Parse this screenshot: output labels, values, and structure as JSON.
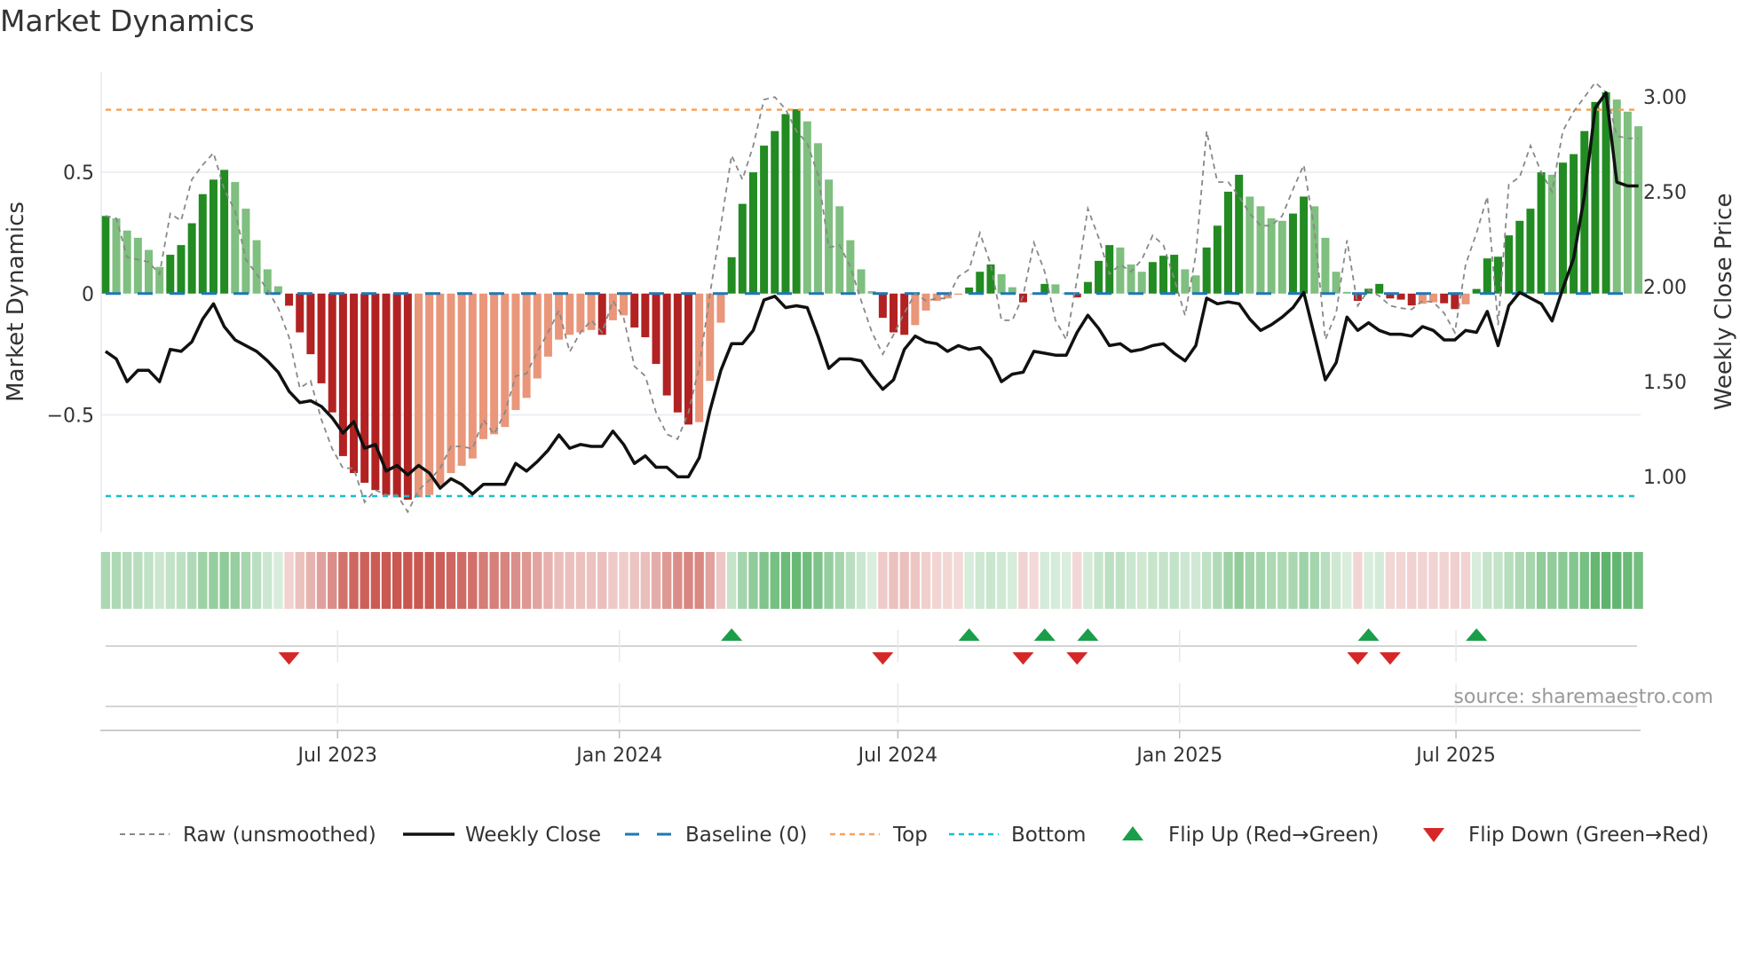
{
  "title": "Market Dynamics",
  "source": "source: sharemaestro.com",
  "colors": {
    "up_strong": "#228b22",
    "up_weak": "#7fbf7f",
    "down_strong": "#b22222",
    "down_weak": "#e9967a",
    "raw": "#888888",
    "close": "#111111",
    "baseline": "#1f77b4",
    "top": "#f4a460",
    "bottom": "#17becf",
    "flip_up": "#1a9e4a",
    "flip_down": "#d62728",
    "heat_green": "#5cb36a",
    "heat_red": "#c9564f"
  },
  "legend": [
    {
      "key": "raw",
      "label": "Raw (unsmoothed)"
    },
    {
      "key": "close",
      "label": "Weekly Close"
    },
    {
      "key": "baseline",
      "label": "Baseline (0)"
    },
    {
      "key": "top",
      "label": "Top"
    },
    {
      "key": "bottom",
      "label": "Bottom"
    },
    {
      "key": "flip_up",
      "label": "Flip Up (Red→Green)"
    },
    {
      "key": "flip_down",
      "label": "Flip Down (Green→Red)"
    }
  ],
  "chart_data": {
    "type": "bar",
    "title": "Market Dynamics",
    "ylabel": "Market Dynamics",
    "y2label": "Weekly Close Price",
    "x_unit": "week index",
    "xlim": [
      -0.4,
      142.2
    ],
    "ylim": [
      -0.985,
      0.914
    ],
    "y2lim": [
      0.707,
      3.13
    ],
    "yticks": [
      {
        "v": 0.5,
        "label": "0.5"
      },
      {
        "v": 0,
        "label": "0"
      },
      {
        "v": -0.5,
        "label": "−0.5"
      }
    ],
    "y2ticks": [
      {
        "v": 3.0,
        "label": "3.00"
      },
      {
        "v": 2.5,
        "label": "2.50"
      },
      {
        "v": 2.0,
        "label": "2.00"
      },
      {
        "v": 1.5,
        "label": "1.50"
      },
      {
        "v": 1.0,
        "label": "1.00"
      }
    ],
    "xticks": [
      {
        "v": 21.5,
        "label": "Jul 2023"
      },
      {
        "v": 47.6,
        "label": "Jan 2024"
      },
      {
        "v": 73.4,
        "label": "Jul 2024"
      },
      {
        "v": 99.5,
        "label": "Jan 2025"
      },
      {
        "v": 125.1,
        "label": "Jul 2025"
      }
    ],
    "top_level": 0.758,
    "bottom_level": -0.835,
    "baseline": 0,
    "smoothed": [
      0.32,
      0.31,
      0.26,
      0.23,
      0.18,
      0.11,
      0.16,
      0.2,
      0.29,
      0.41,
      0.47,
      0.51,
      0.46,
      0.35,
      0.22,
      0.1,
      0.03,
      -0.05,
      -0.16,
      -0.25,
      -0.37,
      -0.49,
      -0.67,
      -0.74,
      -0.78,
      -0.81,
      -0.83,
      -0.84,
      -0.85,
      -0.84,
      -0.83,
      -0.79,
      -0.74,
      -0.71,
      -0.68,
      -0.6,
      -0.58,
      -0.55,
      -0.48,
      -0.43,
      -0.35,
      -0.26,
      -0.19,
      -0.17,
      -0.16,
      -0.15,
      -0.17,
      -0.11,
      -0.09,
      -0.14,
      -0.18,
      -0.29,
      -0.42,
      -0.49,
      -0.54,
      -0.53,
      -0.36,
      -0.12,
      0.15,
      0.37,
      0.5,
      0.61,
      0.67,
      0.74,
      0.76,
      0.71,
      0.62,
      0.47,
      0.36,
      0.22,
      0.1,
      0.01,
      -0.1,
      -0.16,
      -0.17,
      -0.13,
      -0.07,
      -0.03,
      -0.02,
      -0.005,
      0.025,
      0.09,
      0.12,
      0.08,
      0.026,
      -0.036,
      -0.003,
      0.04,
      0.038,
      0.002,
      -0.016,
      0.048,
      0.135,
      0.2,
      0.19,
      0.12,
      0.09,
      0.13,
      0.156,
      0.16,
      0.1,
      0.075,
      0.19,
      0.28,
      0.42,
      0.49,
      0.4,
      0.36,
      0.31,
      0.3,
      0.33,
      0.4,
      0.36,
      0.23,
      0.09,
      0.007,
      -0.03,
      0.02,
      0.04,
      -0.02,
      -0.025,
      -0.049,
      -0.042,
      -0.036,
      -0.04,
      -0.064,
      -0.044,
      0.019,
      0.145,
      0.152,
      0.24,
      0.3,
      0.35,
      0.5,
      0.49,
      0.54,
      0.575,
      0.67,
      0.79,
      0.83,
      0.8,
      0.75,
      0.69
    ],
    "raw": [
      0.32,
      0.31,
      0.15,
      0.14,
      0.13,
      0.08,
      0.33,
      0.3,
      0.47,
      0.53,
      0.58,
      0.43,
      0.34,
      0.14,
      0.08,
      0.015,
      -0.06,
      -0.18,
      -0.39,
      -0.36,
      -0.52,
      -0.64,
      -0.72,
      -0.72,
      -0.86,
      -0.81,
      -0.83,
      -0.83,
      -0.9,
      -0.81,
      -0.77,
      -0.72,
      -0.63,
      -0.63,
      -0.64,
      -0.52,
      -0.58,
      -0.49,
      -0.34,
      -0.33,
      -0.24,
      -0.16,
      -0.07,
      -0.24,
      -0.16,
      -0.11,
      -0.16,
      -0.03,
      -0.1,
      -0.3,
      -0.34,
      -0.49,
      -0.58,
      -0.6,
      -0.49,
      -0.3,
      0.0,
      0.28,
      0.57,
      0.47,
      0.61,
      0.8,
      0.81,
      0.76,
      0.67,
      0.62,
      0.49,
      0.19,
      0.2,
      0.11,
      -0.03,
      -0.16,
      -0.25,
      -0.17,
      -0.08,
      0.0,
      -0.03,
      -0.02,
      -0.02,
      0.07,
      0.1,
      0.25,
      0.12,
      -0.11,
      -0.11,
      -0.01,
      0.21,
      0.09,
      -0.11,
      -0.19,
      0.06,
      0.35,
      0.23,
      0.08,
      0.12,
      0.09,
      0.14,
      0.24,
      0.2,
      0.06,
      -0.09,
      0.16,
      0.67,
      0.46,
      0.46,
      0.4,
      0.33,
      0.28,
      0.28,
      0.32,
      0.43,
      0.53,
      0.26,
      -0.19,
      -0.08,
      0.22,
      -0.05,
      0.015,
      -0.01,
      -0.05,
      -0.06,
      -0.065,
      -0.03,
      -0.035,
      -0.08,
      -0.16,
      0.12,
      0.25,
      0.4,
      -0.13,
      0.45,
      0.48,
      0.61,
      0.5,
      0.42,
      0.67,
      0.75,
      0.81,
      0.87,
      0.83,
      0.65,
      0.64,
      0.64
    ],
    "weekly_close": [
      1.66,
      1.62,
      1.5,
      1.56,
      1.56,
      1.5,
      1.67,
      1.66,
      1.71,
      1.83,
      1.91,
      1.79,
      1.72,
      1.69,
      1.66,
      1.61,
      1.55,
      1.45,
      1.39,
      1.4,
      1.37,
      1.31,
      1.23,
      1.29,
      1.15,
      1.17,
      1.03,
      1.06,
      1.01,
      1.06,
      1.02,
      0.94,
      0.99,
      0.96,
      0.91,
      0.96,
      0.96,
      0.96,
      1.07,
      1.03,
      1.08,
      1.14,
      1.22,
      1.15,
      1.17,
      1.16,
      1.16,
      1.24,
      1.17,
      1.07,
      1.11,
      1.05,
      1.05,
      1.0,
      1.0,
      1.1,
      1.35,
      1.56,
      1.7,
      1.7,
      1.77,
      1.93,
      1.95,
      1.89,
      1.9,
      1.89,
      1.74,
      1.57,
      1.62,
      1.62,
      1.61,
      1.53,
      1.46,
      1.51,
      1.67,
      1.74,
      1.71,
      1.7,
      1.66,
      1.69,
      1.67,
      1.68,
      1.62,
      1.5,
      1.54,
      1.55,
      1.66,
      1.65,
      1.64,
      1.64,
      1.76,
      1.85,
      1.78,
      1.69,
      1.7,
      1.66,
      1.67,
      1.69,
      1.7,
      1.65,
      1.61,
      1.69,
      1.94,
      1.91,
      1.92,
      1.91,
      1.83,
      1.77,
      1.8,
      1.84,
      1.89,
      1.97,
      1.74,
      1.51,
      1.6,
      1.84,
      1.77,
      1.81,
      1.77,
      1.75,
      1.75,
      1.74,
      1.79,
      1.77,
      1.72,
      1.72,
      1.77,
      1.76,
      1.87,
      1.69,
      1.9,
      1.97,
      1.94,
      1.91,
      1.82,
      1.99,
      2.15,
      2.48,
      2.94,
      3.02,
      2.55,
      2.53,
      2.53
    ],
    "flips_up": [
      58,
      80,
      87,
      91,
      117,
      127
    ],
    "flips_down": [
      17,
      72,
      85,
      90,
      116,
      119
    ],
    "legend_position": "bottom"
  }
}
